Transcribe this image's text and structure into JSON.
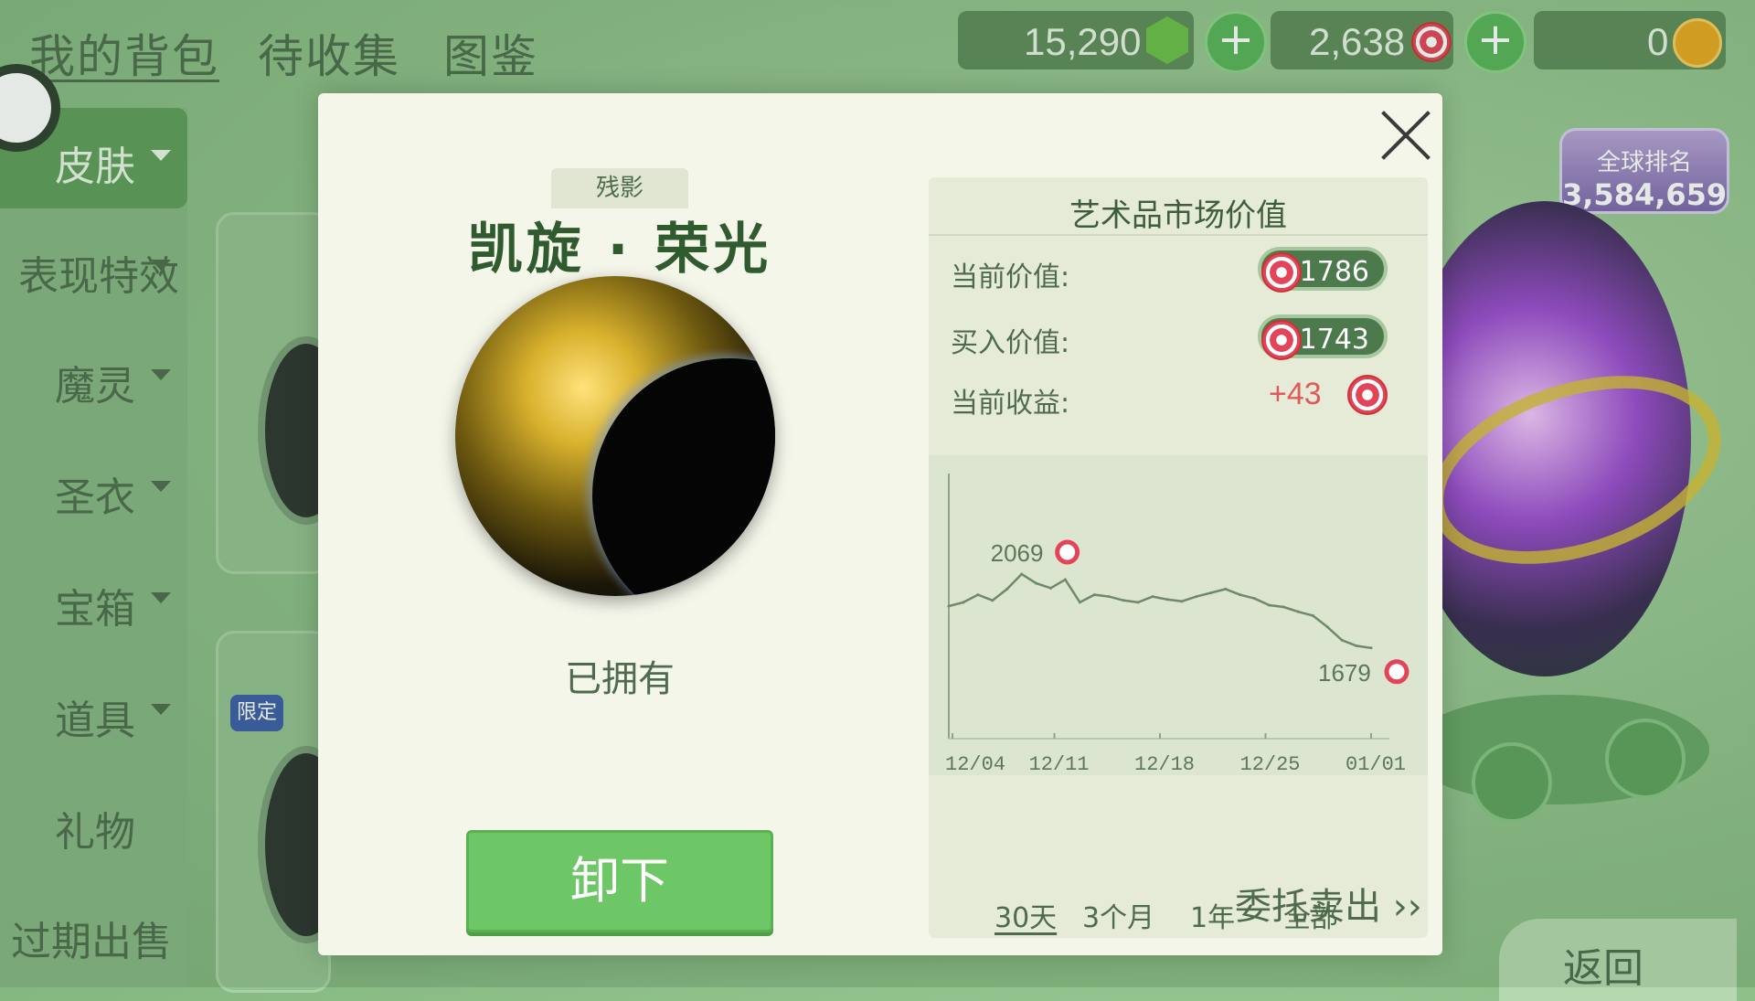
{
  "top_tabs": [
    "我的背包",
    "待收集",
    "图鉴"
  ],
  "currencies": [
    {
      "value": "15,290",
      "icon": "green-gem-icon"
    },
    {
      "value": "2,638",
      "icon": "lollipop-icon"
    },
    {
      "value": "0",
      "icon": "gold-coin-icon"
    }
  ],
  "sidebar": [
    "皮肤",
    "表现特效",
    "魔灵",
    "圣衣",
    "宝箱",
    "道具",
    "礼物",
    "过期出售"
  ],
  "rank": {
    "title": "全球排名",
    "value": "3,584,659"
  },
  "back_label": "返回",
  "limited_badge": "限定",
  "modal": {
    "tag": "残影",
    "title": "凯旋 · 荣光",
    "owned": "已拥有",
    "unequip": "卸下",
    "panel_title": "艺术品市场价值",
    "current_value_label": "当前价值:",
    "current_value": "1786",
    "buy_value_label": "买入价值:",
    "buy_value": "1743",
    "profit_label": "当前收益:",
    "profit": "+43",
    "range_tabs": [
      "30天",
      "3个月",
      "1年",
      "全部"
    ],
    "active_range": "30天",
    "sell_label": "委托卖出 ››"
  },
  "chart_data": {
    "type": "line",
    "x_ticks": [
      "12/04",
      "12/11",
      "12/18",
      "12/25",
      "01/01"
    ],
    "series": [
      {
        "values": [
          1900,
          1920,
          1960,
          1930,
          1990,
          2069,
          2020,
          1995,
          2040,
          1920,
          1960,
          1950,
          1930,
          1920,
          1950,
          1935,
          1925,
          1950,
          1970,
          1990,
          1960,
          1940,
          1905,
          1895,
          1870,
          1850,
          1790,
          1720,
          1690,
          1679
        ]
      }
    ],
    "annotations": [
      {
        "label": "2069",
        "index": 5
      },
      {
        "label": "1679",
        "index": 29
      }
    ],
    "grid": false
  }
}
